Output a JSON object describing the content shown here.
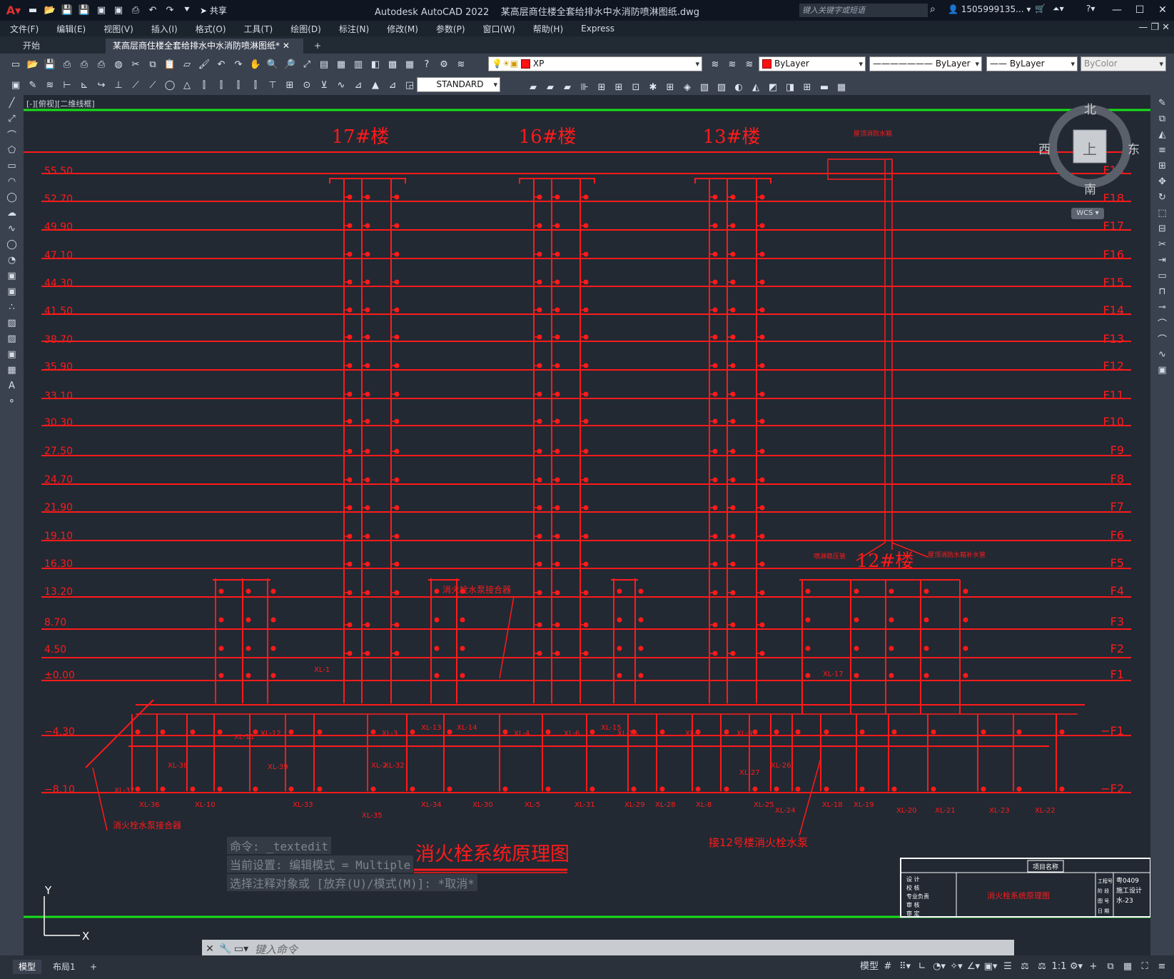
{
  "app": {
    "title": "Autodesk AutoCAD 2022",
    "filename": "某高层商住楼全套给排水中水消防喷淋图纸.dwg",
    "share": "共享",
    "search_placeholder": "键入关键字或短语",
    "user": "1505999135..."
  },
  "menu": [
    "文件(F)",
    "编辑(E)",
    "视图(V)",
    "插入(I)",
    "格式(O)",
    "工具(T)",
    "绘图(D)",
    "标注(N)",
    "修改(M)",
    "参数(P)",
    "窗口(W)",
    "帮助(H)",
    "Express"
  ],
  "tabs": {
    "start": "开始",
    "active": "某高层商住楼全套给排水中水消防喷淋图纸*",
    "add": "+"
  },
  "toolbar": {
    "layer_name": "XP",
    "color": "ByLayer",
    "linetype": "ByLayer",
    "lineweight": "ByLayer",
    "plotstyle": "ByColor",
    "textstyle": "STANDARD"
  },
  "viewport": {
    "label": "[-][俯视][二维线框]"
  },
  "compass": {
    "north": "北",
    "south": "南",
    "east": "东",
    "west": "西",
    "top": "上",
    "wcs": "WCS"
  },
  "drawing": {
    "title": "消火栓系统原理图",
    "buildings": [
      "17#楼",
      "16#楼",
      "13#楼",
      "12#楼"
    ],
    "elevations": [
      "55.50",
      "52.70",
      "49.90",
      "47.10",
      "44.30",
      "41.50",
      "38.70",
      "35.90",
      "33.10",
      "30.30",
      "27.50",
      "24.70",
      "21.90",
      "19.10",
      "16.30",
      "13.20",
      "8.70",
      "4.50",
      "±0.00",
      "−4.30",
      "−8.10"
    ],
    "floors": [
      "F19",
      "F18",
      "F17",
      "F16",
      "F15",
      "F14",
      "F13",
      "F12",
      "F11",
      "F10",
      "F9",
      "F8",
      "F7",
      "F6",
      "F5",
      "F4",
      "F3",
      "F2",
      "F1",
      "−F1",
      "−F2"
    ],
    "notes": {
      "pump_adapter": "消火栓水泵接合器",
      "pump_adapter_2": "消火栓水泵接合器",
      "connect_pump": "接12号楼消火栓水泵",
      "water_tank": "屋顶消防水箱",
      "pressure_pipe": "喷淋稳压管",
      "tank_pipe": "屋顶消防水箱补水管"
    },
    "risers": [
      "XL-1",
      "XL-2",
      "XL-3",
      "XL-4",
      "XL-5",
      "XL-6",
      "XL-7",
      "XL-8",
      "XL-9",
      "XL-10",
      "XL-11",
      "XL-12",
      "XL-13",
      "XL-14",
      "XL-15",
      "XL-16",
      "XL-17",
      "XL-18",
      "XL-19",
      "XL-20",
      "XL-21",
      "XL-22",
      "XL-23",
      "XL-24",
      "XL-25",
      "XL-26",
      "XL-27",
      "XL-28",
      "XL-29",
      "XL-30",
      "XL-31",
      "XL-32",
      "XL-33",
      "XL-34",
      "XL-35",
      "XL-36",
      "XL-37",
      "XL-38",
      "XL-39"
    ],
    "titleblock": {
      "header": "项目名称",
      "drawing_name": "消火栓系统原理图",
      "project_no": "粤0409",
      "stage": "施工设计",
      "sheet": "水-23",
      "rows": [
        "设 计",
        "校 核",
        "专业负责",
        "审 核",
        "审 定"
      ],
      "right_labels": [
        "工程号",
        "阶 段",
        "图 号",
        "日 期"
      ]
    }
  },
  "command": {
    "history": [
      "命令: _textedit",
      "当前设置: 编辑模式 = Multiple",
      "选择注释对象或 [放弃(U)/模式(M)]: *取消*"
    ],
    "placeholder": "键入命令"
  },
  "status": {
    "model_tab": "模型",
    "layout_tab": "布局1",
    "mode": "模型",
    "scale": "1:1"
  },
  "colors": {
    "drawing_red": "#ff1a1a",
    "grid_green": "#19e019",
    "background": "#222933"
  }
}
